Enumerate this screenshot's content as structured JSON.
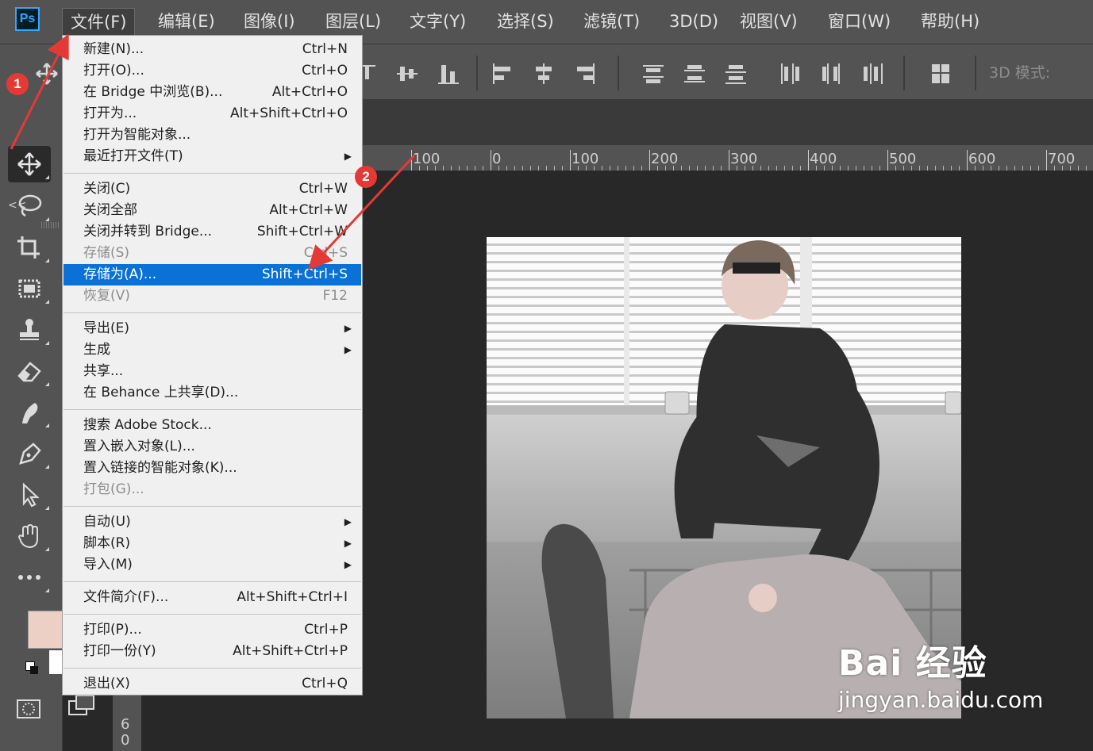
{
  "app": {
    "logo_text": "Ps"
  },
  "menubar": {
    "items": [
      {
        "label": "文件(F)",
        "active": true
      },
      {
        "label": "编辑(E)"
      },
      {
        "label": "图像(I)"
      },
      {
        "label": "图层(L)"
      },
      {
        "label": "文字(Y)"
      },
      {
        "label": "选择(S)"
      },
      {
        "label": "滤镜(T)"
      },
      {
        "label": "3D(D)"
      },
      {
        "label": "视图(V)"
      },
      {
        "label": "窗口(W)"
      },
      {
        "label": "帮助(H)"
      }
    ]
  },
  "options_bar": {
    "mode_label": "3D 模式:"
  },
  "ruler": {
    "labels": [
      "100",
      "0",
      "100",
      "200",
      "300",
      "400",
      "500",
      "600",
      "700"
    ],
    "vertical_digits": [
      "6",
      "0"
    ]
  },
  "toolbar": {
    "collapse_label": "<<",
    "tools": [
      {
        "name": "move-tool",
        "icon": "move-icon",
        "active": true
      },
      {
        "name": "lasso-tool",
        "icon": "lasso-icon"
      },
      {
        "name": "crop-tool",
        "icon": "crop-icon"
      },
      {
        "name": "frame-tool",
        "icon": "frame-icon"
      },
      {
        "name": "stamp-tool",
        "icon": "stamp-icon"
      },
      {
        "name": "eraser-tool",
        "icon": "eraser-icon"
      },
      {
        "name": "smudge-tool",
        "icon": "smudge-icon"
      },
      {
        "name": "pen-tool",
        "icon": "pen-icon"
      },
      {
        "name": "selection-tool",
        "icon": "arrow-icon"
      },
      {
        "name": "hand-tool",
        "icon": "hand-icon"
      },
      {
        "name": "more-tools",
        "icon": "ellipsis-icon"
      }
    ],
    "foreground_color": "#ecd0c6",
    "background_color": "#ffffff"
  },
  "file_menu": {
    "items": [
      {
        "label": "新建(N)...",
        "shortcut": "Ctrl+N"
      },
      {
        "label": "打开(O)...",
        "shortcut": "Ctrl+O"
      },
      {
        "label": "在 Bridge 中浏览(B)...",
        "shortcut": "Alt+Ctrl+O"
      },
      {
        "label": "打开为...",
        "shortcut": "Alt+Shift+Ctrl+O"
      },
      {
        "label": "打开为智能对象...",
        "shortcut": ""
      },
      {
        "label": "最近打开文件(T)",
        "shortcut": "",
        "submenu": true
      },
      {
        "separator": true
      },
      {
        "label": "关闭(C)",
        "shortcut": "Ctrl+W"
      },
      {
        "label": "关闭全部",
        "shortcut": "Alt+Ctrl+W"
      },
      {
        "label": "关闭并转到 Bridge...",
        "shortcut": "Shift+Ctrl+W"
      },
      {
        "label": "存储(S)",
        "shortcut": "Ctrl+S",
        "disabled": true
      },
      {
        "label": "存储为(A)...",
        "shortcut": "Shift+Ctrl+S",
        "highlight": true
      },
      {
        "label": "恢复(V)",
        "shortcut": "F12",
        "disabled": true
      },
      {
        "separator": true
      },
      {
        "label": "导出(E)",
        "shortcut": "",
        "submenu": true
      },
      {
        "label": "生成",
        "shortcut": "",
        "submenu": true
      },
      {
        "label": "共享...",
        "shortcut": ""
      },
      {
        "label": "在 Behance 上共享(D)...",
        "shortcut": ""
      },
      {
        "separator": true
      },
      {
        "label": "搜索 Adobe Stock...",
        "shortcut": ""
      },
      {
        "label": "置入嵌入对象(L)...",
        "shortcut": ""
      },
      {
        "label": "置入链接的智能对象(K)...",
        "shortcut": ""
      },
      {
        "label": "打包(G)...",
        "shortcut": "",
        "disabled": true
      },
      {
        "separator": true
      },
      {
        "label": "自动(U)",
        "shortcut": "",
        "submenu": true
      },
      {
        "label": "脚本(R)",
        "shortcut": "",
        "submenu": true
      },
      {
        "label": "导入(M)",
        "shortcut": "",
        "submenu": true
      },
      {
        "separator": true
      },
      {
        "label": "文件简介(F)...",
        "shortcut": "Alt+Shift+Ctrl+I"
      },
      {
        "separator": true
      },
      {
        "label": "打印(P)...",
        "shortcut": "Ctrl+P"
      },
      {
        "label": "打印一份(Y)",
        "shortcut": "Alt+Shift+Ctrl+P"
      },
      {
        "separator": true
      },
      {
        "label": "退出(X)",
        "shortcut": "Ctrl+Q"
      }
    ]
  },
  "annotations": {
    "badge_1": "1",
    "badge_2": "2",
    "arrow_color": "#e53935"
  },
  "watermark": {
    "line1": "Bai 经验",
    "line2": "jingyan.baidu.com"
  }
}
